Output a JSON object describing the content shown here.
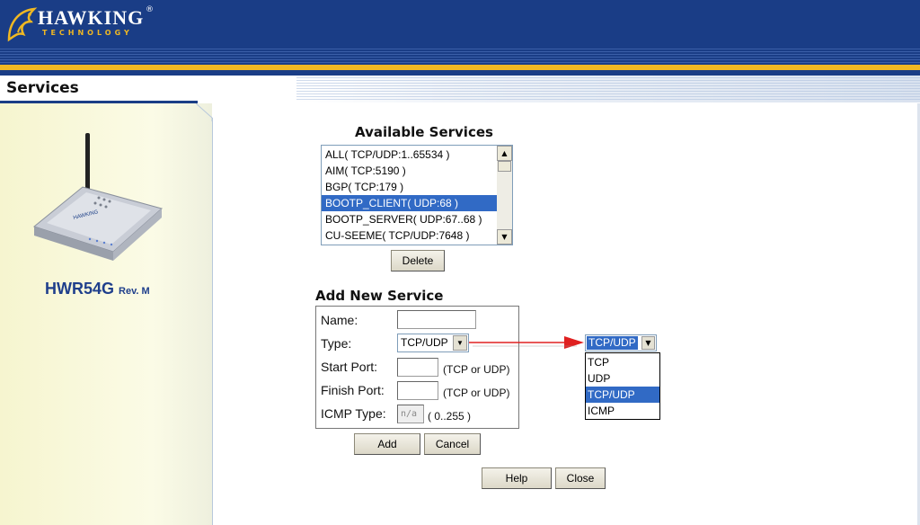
{
  "brand": {
    "name": "HAWKING",
    "tagline": "TECHNOLOGY",
    "registered": "®",
    "colors": {
      "navy": "#1a3d86",
      "gold": "#f0b823",
      "selection": "#316ac5"
    }
  },
  "page": {
    "title": "Services"
  },
  "device": {
    "model": "HWR54G",
    "revision": "Rev. M"
  },
  "available_services": {
    "title": "Available Services",
    "items": [
      {
        "label": "ALL( TCP/UDP:1..65534 )",
        "selected": false
      },
      {
        "label": "AIM( TCP:5190 )",
        "selected": false
      },
      {
        "label": "BGP( TCP:179 )",
        "selected": false
      },
      {
        "label": "BOOTP_CLIENT( UDP:68 )",
        "selected": true
      },
      {
        "label": "BOOTP_SERVER( UDP:67..68 )",
        "selected": false
      },
      {
        "label": "CU-SEEME( TCP/UDP:7648 )",
        "selected": false
      }
    ],
    "delete_label": "Delete",
    "scroll_up_icon": "▲",
    "scroll_down_icon": "▼"
  },
  "add_new_service": {
    "title": "Add New Service",
    "name_label": "Name:",
    "name_value": "",
    "type_label": "Type:",
    "type_value": "TCP/UDP",
    "start_port_label": "Start Port:",
    "start_port_value": "",
    "start_port_hint": "(TCP or UDP)",
    "finish_port_label": "Finish Port:",
    "finish_port_value": "",
    "finish_port_hint": "(TCP or UDP)",
    "icmp_label": "ICMP Type:",
    "icmp_value": "n/a",
    "icmp_hint": "( 0..255 )",
    "add_label": "Add",
    "cancel_label": "Cancel"
  },
  "type_dropdown": {
    "selected": "TCP/UDP",
    "options": [
      "TCP",
      "UDP",
      "TCP/UDP",
      "ICMP"
    ],
    "highlighted_index": 2,
    "arrow_icon": "▼"
  },
  "footer": {
    "help_label": "Help",
    "close_label": "Close"
  }
}
